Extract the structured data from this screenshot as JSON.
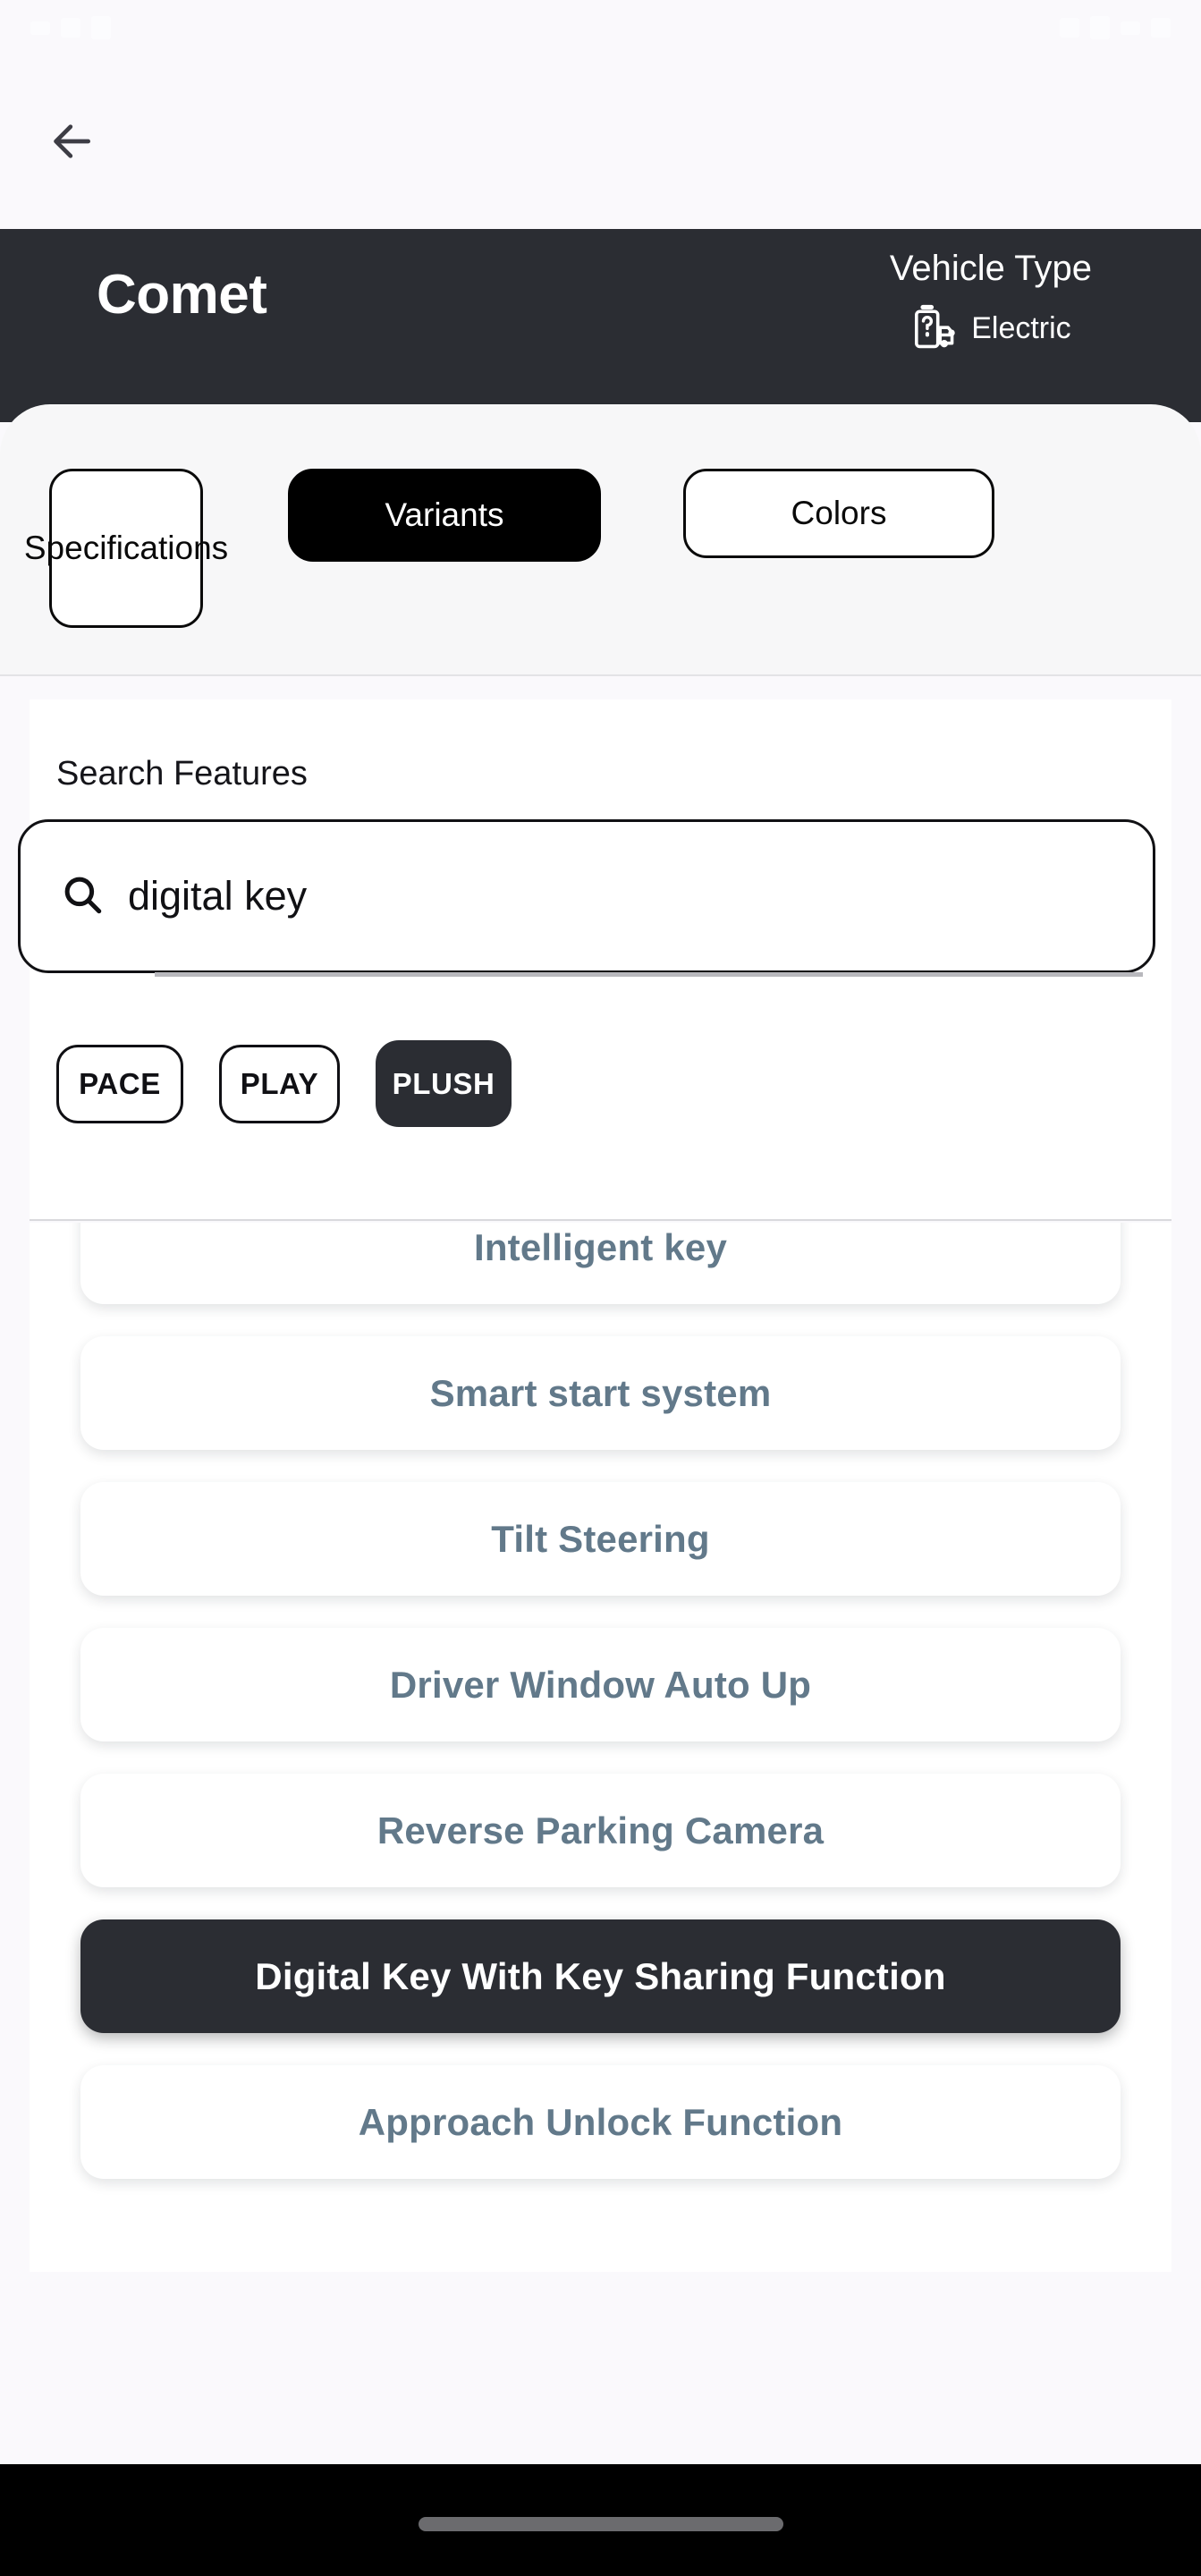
{
  "statusbar": {
    "left_icons": [
      "signal-icon",
      "wifi-icon",
      "app-badge-icon"
    ],
    "right_icons": [
      "vibrate-icon",
      "signal-bars-icon",
      "wifi-icon",
      "battery-icon"
    ]
  },
  "appbar": {
    "back_icon": "arrow-left-icon"
  },
  "header": {
    "brand": "Comet",
    "vehicle_type_label": "Vehicle Type",
    "vehicle_type_value": "Electric",
    "vehicle_type_icon": "battery-unknown-vehicle-icon",
    "background_color": "#2b2d33"
  },
  "tabs": {
    "items": [
      {
        "label": "Specifications",
        "active": false
      },
      {
        "label": "Variants",
        "active": true
      },
      {
        "label": "Colors",
        "active": false
      }
    ]
  },
  "search": {
    "label": "Search Features",
    "icon": "search-icon",
    "value": "digital key",
    "placeholder": "Search Features"
  },
  "variants": {
    "items": [
      {
        "label": "PACE",
        "active": false
      },
      {
        "label": "PLAY",
        "active": false
      },
      {
        "label": "PLUSH",
        "active": true
      }
    ]
  },
  "features": {
    "items": [
      {
        "label": "Intelligent key",
        "highlighted": false
      },
      {
        "label": "Smart start system",
        "highlighted": false
      },
      {
        "label": "Tilt Steering",
        "highlighted": false
      },
      {
        "label": "Driver Window Auto Up",
        "highlighted": false
      },
      {
        "label": "Reverse Parking Camera",
        "highlighted": false
      },
      {
        "label": "Digital Key With Key Sharing Function",
        "highlighted": true
      },
      {
        "label": "Approach Unlock Function",
        "highlighted": false
      }
    ]
  },
  "colors": {
    "accent_dark": "#2b2d33",
    "feature_text": "#62798a",
    "active_tab_bg": "#000000",
    "page_bg": "#f4f4f5"
  },
  "navbar": {
    "home_indicator": "home-indicator"
  }
}
